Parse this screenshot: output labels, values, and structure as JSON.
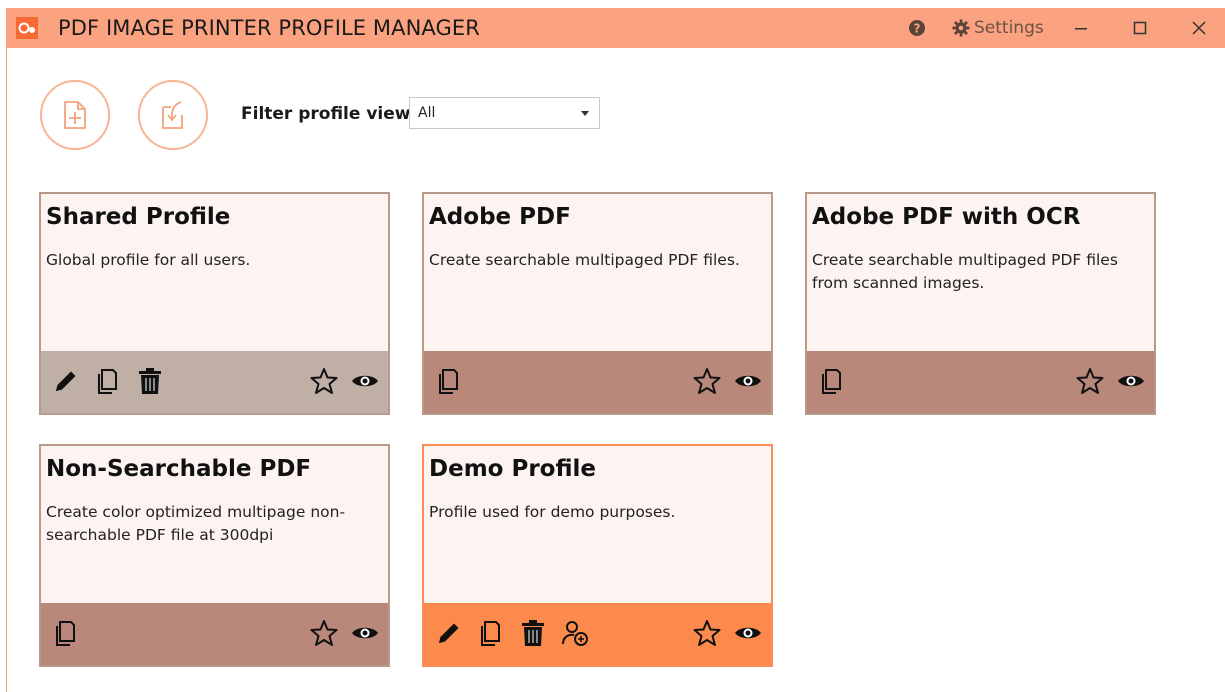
{
  "window": {
    "title": "PDF IMAGE PRINTER PROFILE MANAGER",
    "settings_label": "Settings"
  },
  "toolbar": {
    "filter_label": "Filter profile views",
    "filter_value": "All"
  },
  "profiles": [
    {
      "title": "Shared Profile",
      "description": "Global profile for all users."
    },
    {
      "title": "Adobe PDF",
      "description": "Create searchable multipaged PDF files."
    },
    {
      "title": "Adobe PDF with OCR",
      "description": "Create searchable multipaged PDF files from scanned images."
    },
    {
      "title": "Non-Searchable PDF",
      "description": "Create color optimized multipage non-searchable PDF file at 300dpi"
    },
    {
      "title": "Demo Profile",
      "description": "Profile used for demo purposes."
    }
  ],
  "colors": {
    "titlebar": "#fba381",
    "card_background": "#fdf4f1",
    "footer_default": "#b9887a",
    "footer_shared": "#c0afa5",
    "footer_selected": "#fd8a4d",
    "accent_border": "#f6b594"
  },
  "icons": {
    "edit": "pencil-icon",
    "copy": "copy-icon",
    "delete": "trash-icon",
    "favorite": "star-icon",
    "view": "eye-icon",
    "share": "user-share-icon",
    "new_profile": "new-document-icon",
    "import_profile": "import-icon"
  }
}
